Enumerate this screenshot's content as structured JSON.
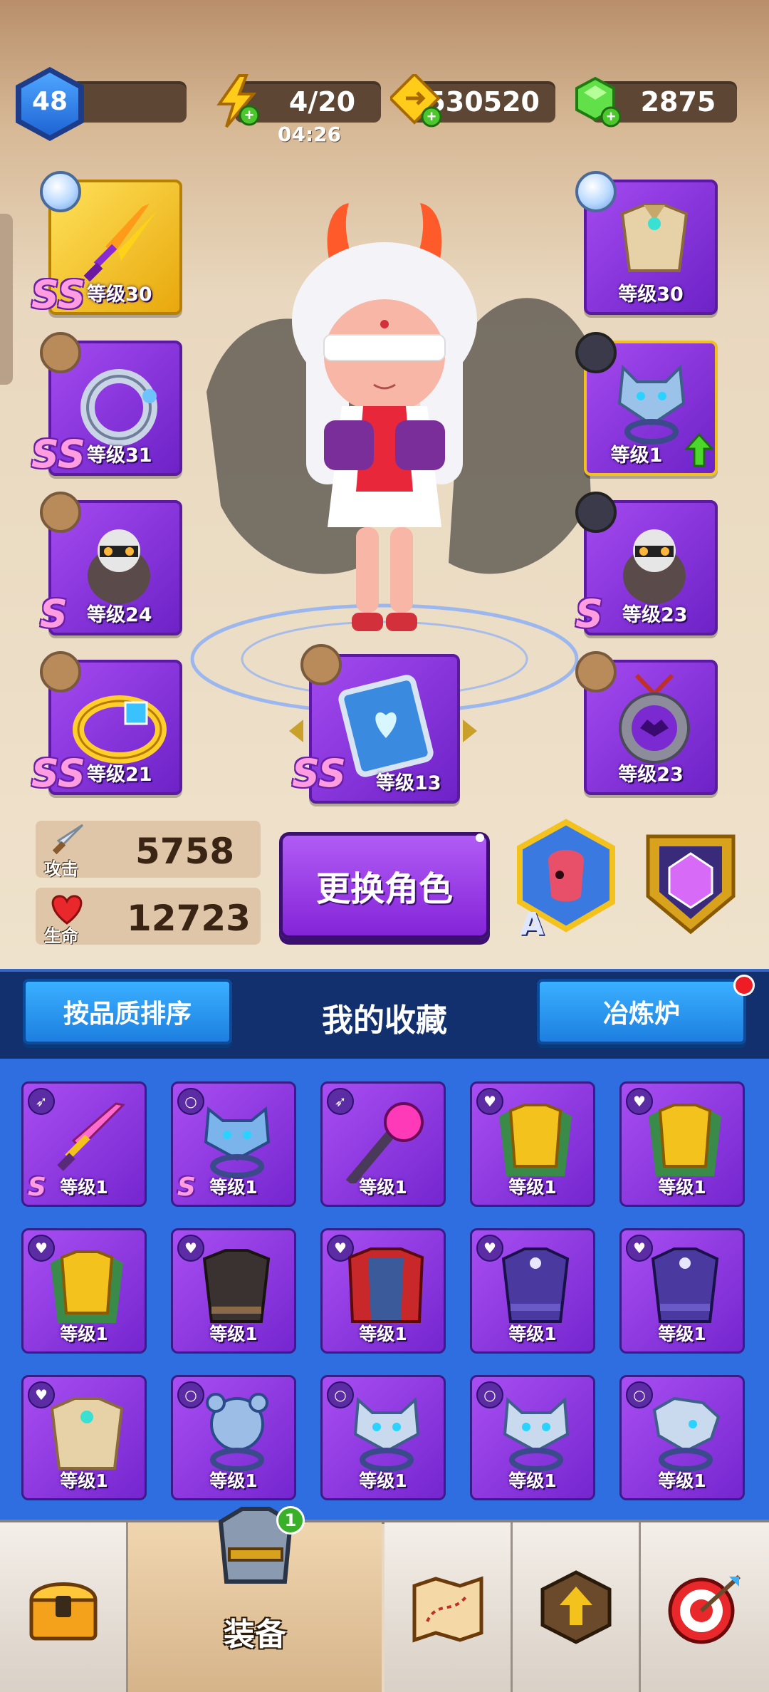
{
  "header": {
    "level": "48",
    "energy": "4/20",
    "energy_timer": "04:26",
    "coins": "530520",
    "gems": "2875"
  },
  "slots": {
    "left": [
      {
        "grade": "SS",
        "level": "等级30"
      },
      {
        "grade": "SS",
        "level": "等级31"
      },
      {
        "grade": "S",
        "level": "等级24"
      },
      {
        "grade": "SS",
        "level": "等级21"
      }
    ],
    "right": [
      {
        "grade": "",
        "level": "等级30"
      },
      {
        "grade": "",
        "level": "等级1"
      },
      {
        "grade": "S",
        "level": "等级23"
      },
      {
        "grade": "",
        "level": "等级23"
      }
    ],
    "center": {
      "grade": "SS",
      "level": "等级13"
    }
  },
  "stats": {
    "attack_label": "攻击",
    "attack_value": "5758",
    "hp_label": "生命",
    "hp_value": "12723"
  },
  "change_character_label": "更换角色",
  "rank_letter": "A",
  "collection": {
    "sort_button": "按品质排序",
    "title": "我的收藏",
    "forge_button": "冶炼炉",
    "rows": [
      [
        {
          "grade": "S",
          "level": "等级1",
          "icon": "sword-icon"
        },
        {
          "grade": "S",
          "level": "等级1",
          "icon": "ring-icon"
        },
        {
          "grade": "",
          "level": "等级1",
          "icon": "staff-icon"
        },
        {
          "grade": "",
          "level": "等级1",
          "icon": "armor-icon"
        },
        {
          "grade": "",
          "level": "等级1",
          "icon": "armor-icon"
        }
      ],
      [
        {
          "grade": "",
          "level": "等级1",
          "icon": "armor-icon"
        },
        {
          "grade": "",
          "level": "等级1",
          "icon": "armor-icon"
        },
        {
          "grade": "",
          "level": "等级1",
          "icon": "armor-icon"
        },
        {
          "grade": "",
          "level": "等级1",
          "icon": "armor-icon"
        },
        {
          "grade": "",
          "level": "等级1",
          "icon": "armor-icon"
        }
      ],
      [
        {
          "grade": "",
          "level": "等级1",
          "icon": "armor-icon"
        },
        {
          "grade": "",
          "level": "等级1",
          "icon": "ring-icon"
        },
        {
          "grade": "",
          "level": "等级1",
          "icon": "ring-icon"
        },
        {
          "grade": "",
          "level": "等级1",
          "icon": "ring-icon"
        },
        {
          "grade": "",
          "level": "等级1",
          "icon": "ring-icon"
        }
      ]
    ]
  },
  "bottom_nav": {
    "active_label": "装备",
    "badge": "1"
  },
  "colors": {
    "purple": "#8a36e0",
    "blue_button": "#2b98f0",
    "gold": "#f4c21c"
  }
}
